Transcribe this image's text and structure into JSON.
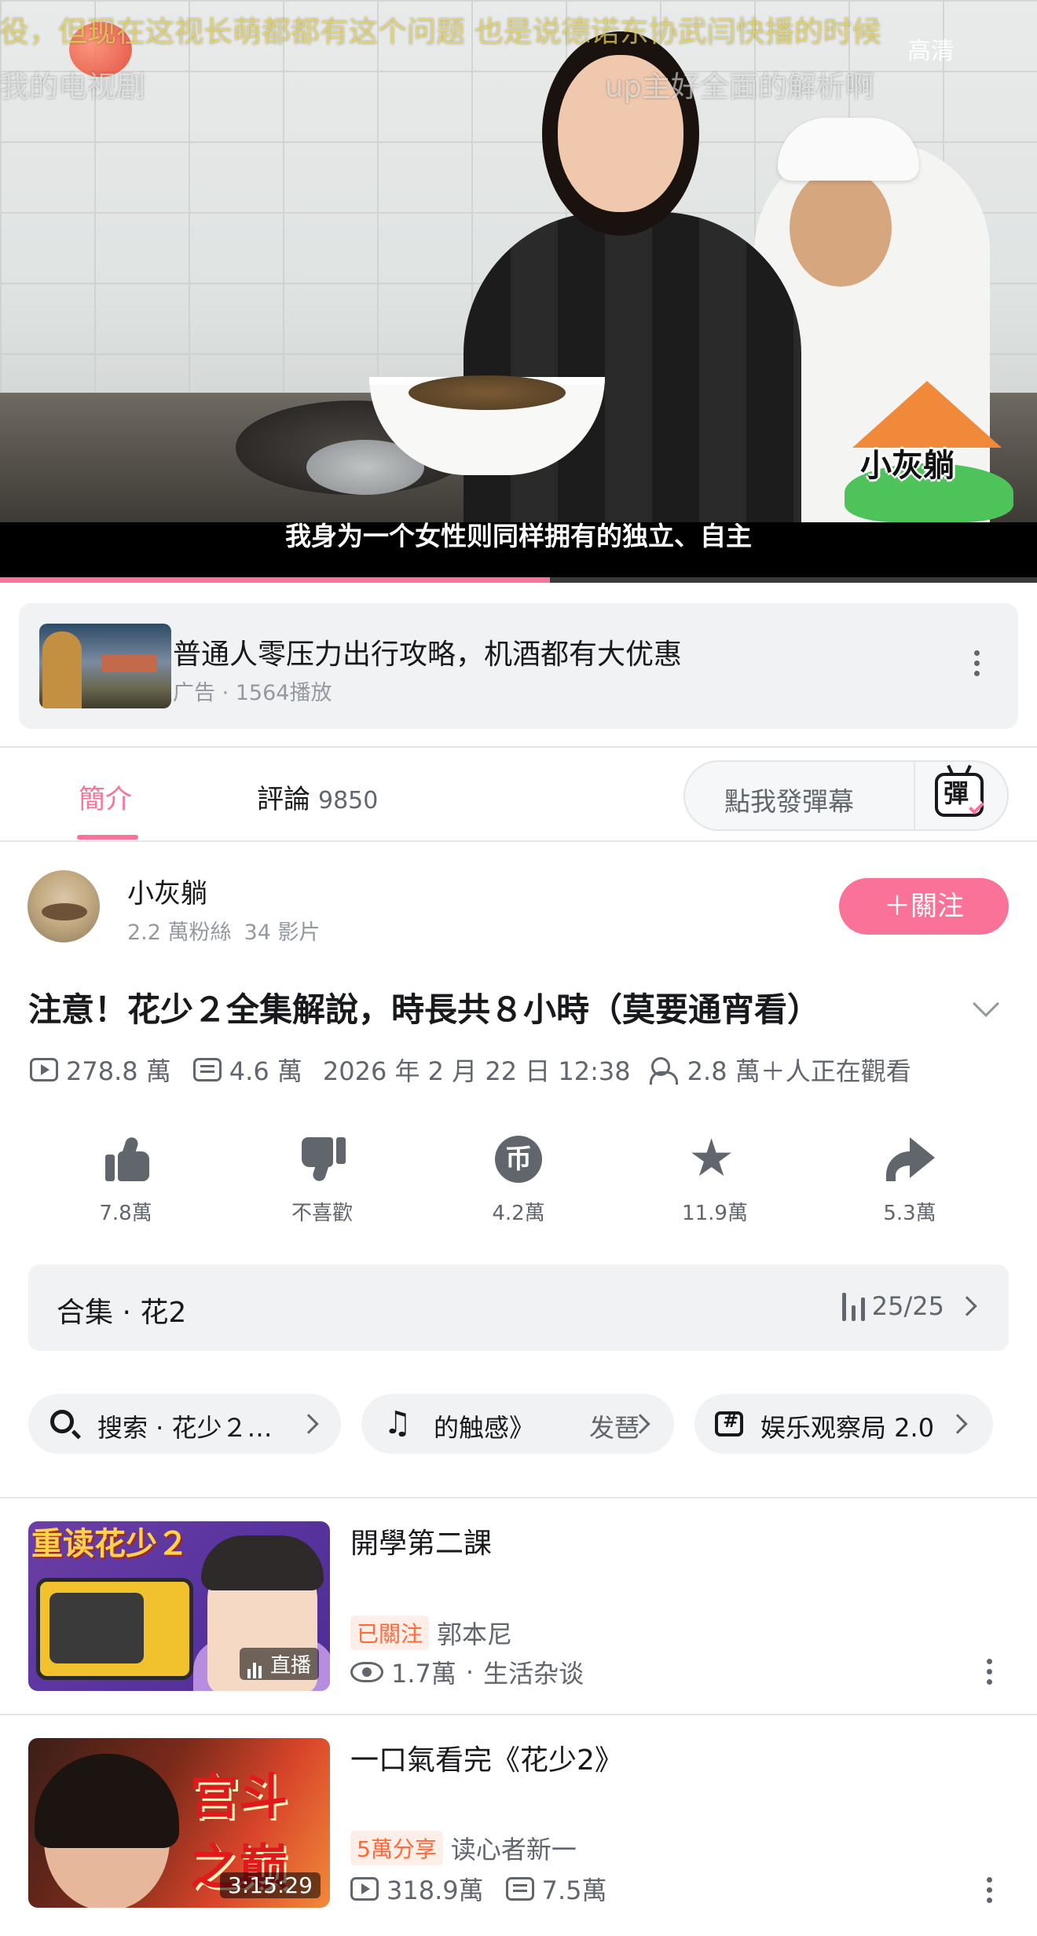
{
  "player": {
    "danmaku_1": "役，但现在这视长萌都都有这个问题 也是说德诺东协武闫快播的时候",
    "danmaku_2": "我的电视剧",
    "danmaku_3": "up主好全面的解析啊",
    "quality": "高清",
    "watermark": "小灰躺",
    "subtitle": "我身为一个女性则同样拥有的独立、自主",
    "progress_fraction": 0.53
  },
  "ad": {
    "title": "普通人零压力出行攻略，机酒都有大优惠",
    "meta": "广告 · 1564播放"
  },
  "tabs": {
    "intro": "簡介",
    "comments": "評論",
    "comments_count": "9850",
    "danmaku_placeholder": "點我發彈幕",
    "danmaku_icon_char": "彈"
  },
  "uploader": {
    "name": "小灰躺",
    "fans": "2.2 萬粉絲",
    "videos": "34 影片",
    "follow": "＋關注"
  },
  "video": {
    "title": "注意！花少２全集解說，時長共８小時（莫要通宵看）",
    "views": "278.8 萬",
    "danmaku": "4.6 萬",
    "date": "2026 年 2 月 22 日 12:38",
    "watching": "2.8 萬＋人正在觀看"
  },
  "actions": {
    "like": "7.8萬",
    "dislike": "不喜歡",
    "coin": "4.2萬",
    "coin_glyph": "币",
    "favorite": "11.9萬",
    "share": "5.3萬"
  },
  "collection": {
    "title": "合集 · 花2",
    "progress": "25/25"
  },
  "chips": {
    "search": "搜索 · 花少２…",
    "music_left": "的触感》",
    "music_right": "发琶",
    "topic": "娱乐观察局 2.0"
  },
  "related": [
    {
      "title": "開學第二課",
      "badge": "已關注",
      "up": "郭本尼",
      "views": "1.7萬",
      "category": "生活杂谈",
      "thumb_text": "重读花少２",
      "tag": "直播"
    },
    {
      "title": "一口氣看完《花少2》",
      "badge": "5萬分享",
      "up": "读心者新一",
      "views": "318.9萬",
      "danmaku": "7.5萬",
      "thumb_text": "宫斗之巅",
      "duration": "3:15:29"
    }
  ],
  "colors": {
    "accent": "#fb7299",
    "text": "#18191c",
    "muted": "#61666d",
    "badge": "#ff6a3c"
  }
}
